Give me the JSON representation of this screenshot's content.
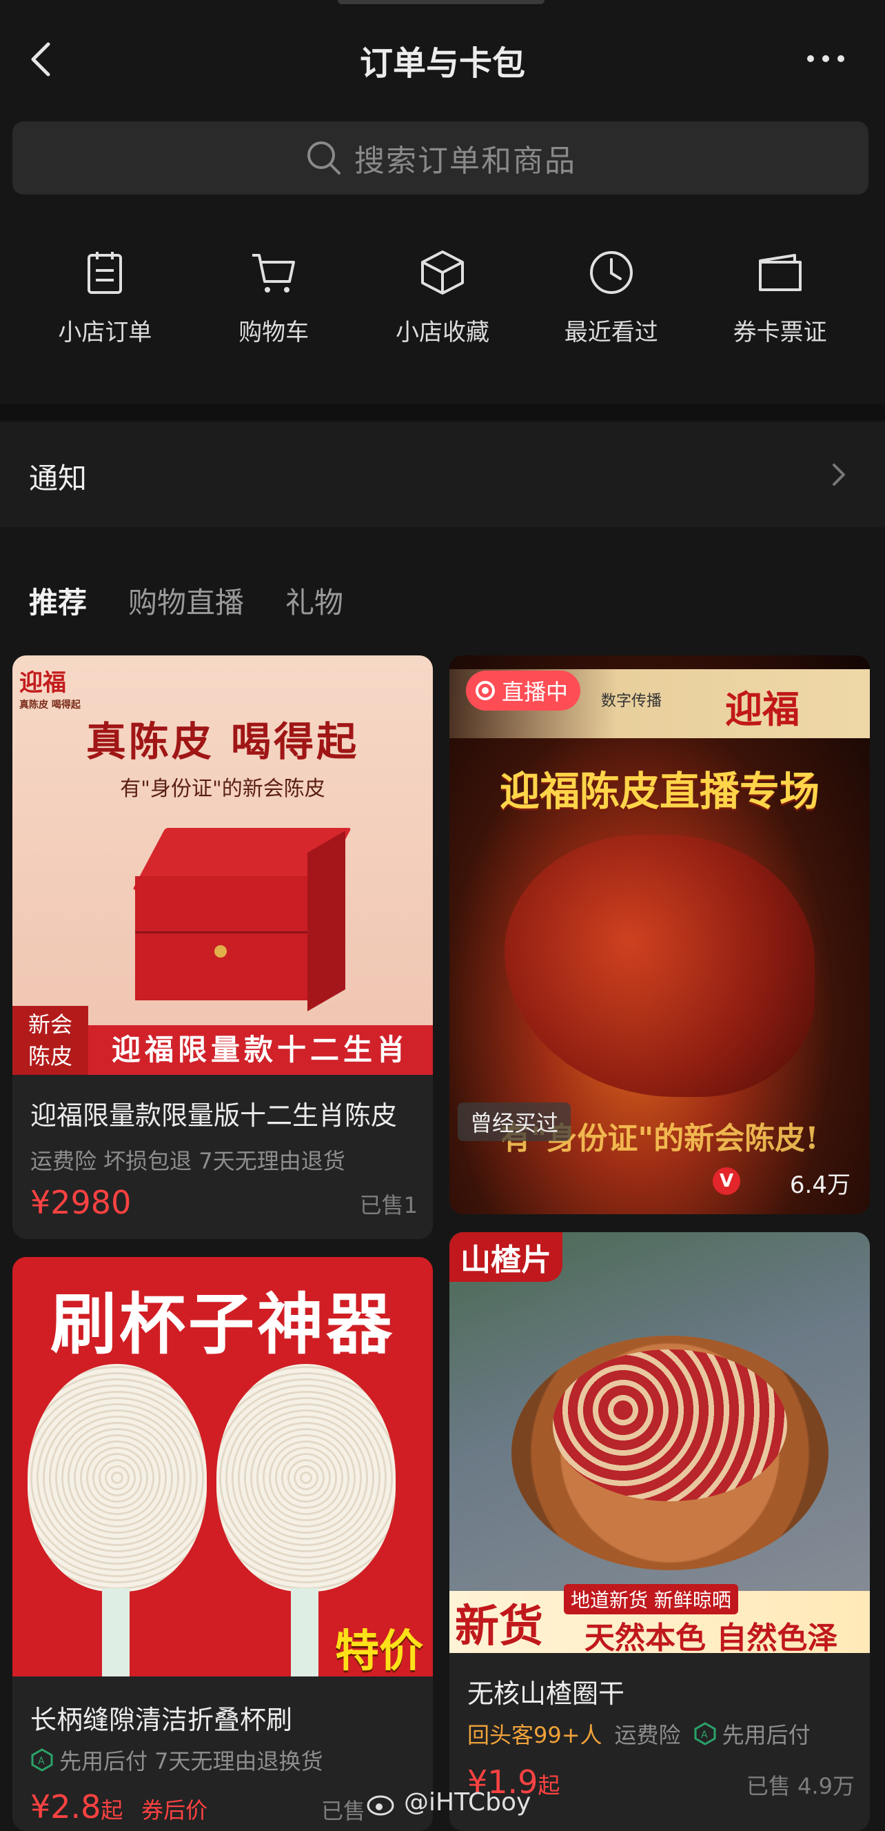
{
  "header": {
    "title": "订单与卡包"
  },
  "search": {
    "placeholder": "搜索订单和商品"
  },
  "quick_actions": [
    {
      "label": "小店订单",
      "icon": "clipboard-icon"
    },
    {
      "label": "购物车",
      "icon": "cart-icon"
    },
    {
      "label": "小店收藏",
      "icon": "box-icon"
    },
    {
      "label": "最近看过",
      "icon": "clock-icon"
    },
    {
      "label": "券卡票证",
      "icon": "wallet-icon"
    }
  ],
  "notice": {
    "label": "通知"
  },
  "tabs": [
    {
      "label": "推荐",
      "active": true
    },
    {
      "label": "购物直播"
    },
    {
      "label": "礼物"
    }
  ],
  "products": [
    {
      "image": {
        "brand": "迎福",
        "brand_sub": "真陈皮 喝得起",
        "headline": "真陈皮 喝得起",
        "subline": "有\"身份证\"的新会陈皮",
        "corner": "新会\n陈皮",
        "banner": "迎福限量款十二生肖"
      },
      "title": "迎福限量款限量版十二生肖陈皮",
      "tags": "运费险  坏损包退  7天无理由退货",
      "price": "¥2980",
      "sold": "已售1"
    },
    {
      "live": true,
      "live_label": "直播中",
      "image": {
        "brand": "迎福",
        "headline": "迎福陈皮直播专场",
        "subline": "有\"身份证\"的新会陈皮!",
        "sponsor": "数字传播"
      },
      "bought_label": "曾经买过",
      "viewers": "6.4万"
    },
    {
      "image": {
        "headline": "刷杯子神器",
        "corner": "特价"
      },
      "title": "长柄缝隙清洁折叠杯刷",
      "tags": "先用后付  7天无理由退换货",
      "price": "¥2.8",
      "price_suffix": "起",
      "coupon": "券后价",
      "sold": "已售"
    },
    {
      "image": {
        "corner": "山楂片",
        "badge": "新货",
        "subline1": "地道新货 新鲜晾晒",
        "subline2": "天然本色 自然色泽"
      },
      "title": "无核山楂圈干",
      "tags_hl": "回头客99+人",
      "tags": "运费险",
      "tag_extra": "先用后付",
      "price": "¥1.9",
      "price_suffix": "起",
      "sold": "已售 4.9万"
    }
  ],
  "watermark": "@iHTCboy",
  "colors": {
    "background": "#161616",
    "price": "#ff4242",
    "live": "#ff4d55"
  }
}
